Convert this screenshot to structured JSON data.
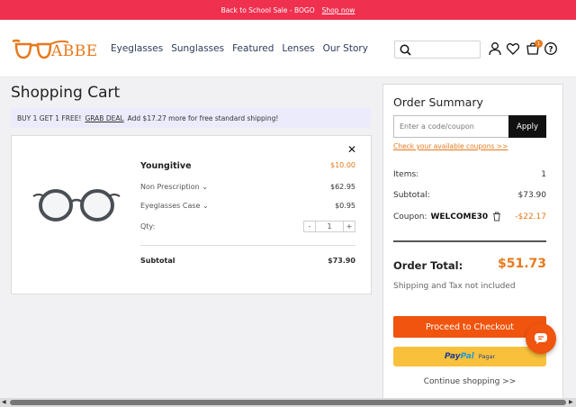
{
  "promo": {
    "text": "Back to School Sale - BOGO",
    "link": "Shop now"
  },
  "header": {
    "brand": "ABBE",
    "nav": [
      "Eyeglasses",
      "Sunglasses",
      "Featured",
      "Lenses",
      "Our Story"
    ],
    "cart_count": "1"
  },
  "cart": {
    "title": "Shopping Cart",
    "deal": {
      "prefix": "BUY 1 GET 1 FREE!",
      "link": "GRAB DEAL",
      "suffix": "Add $17.27 more for free standard shipping!"
    },
    "item": {
      "name": "Youngitive",
      "price": "$10.00",
      "prescription_label": "Non Prescription",
      "prescription_price": "$62.95",
      "case_label": "Eyeglasses Case",
      "case_price": "$0.95",
      "qty_label": "Qty:",
      "qty_minus": "-",
      "qty_value": "1",
      "qty_plus": "+",
      "subtotal_label": "Subtotal",
      "subtotal_value": "$73.90"
    }
  },
  "summary": {
    "title": "Order Summary",
    "coupon_placeholder": "Enter a code/coupon",
    "apply_label": "Apply",
    "check_coupons": "Check your available coupons >>",
    "items_label": "Items:",
    "items_value": "1",
    "subtotal_label": "Subtotal:",
    "subtotal_value": "$73.90",
    "coupon_label": "Coupon:",
    "coupon_code": "WELCOME30",
    "coupon_value": "-$22.17",
    "total_label": "Order Total:",
    "total_value": "$51.73",
    "shipping_note": "Shipping and Tax not included",
    "checkout_label": "Proceed to Checkout",
    "paypal_pay": "Pay",
    "paypal_pal": "Pal",
    "paypal_pagar": "Pagar",
    "continue_label": "Continue shopping >>"
  },
  "colors": {
    "promo_bg": "#f0304f",
    "accent": "#e8791c",
    "checkout": "#f0540e",
    "paypal": "#f9c13b"
  }
}
